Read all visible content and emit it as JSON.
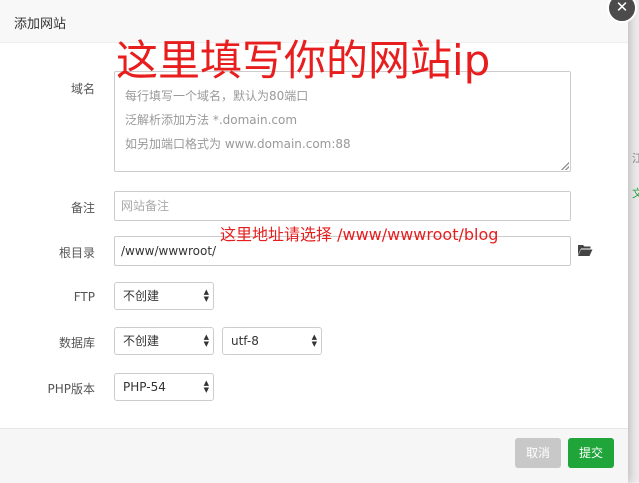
{
  "background": {
    "right_text": "文",
    "right_char": "江"
  },
  "dialog": {
    "title": "添加网站",
    "close_symbol": "✕"
  },
  "annotations": {
    "domain_hint": "这里填写你的网站ip",
    "path_hint": "这里地址请选择 /www/wwwroot/blog"
  },
  "form": {
    "domain": {
      "label": "域名",
      "placeholder_lines": [
        "每行填写一个域名，默认为80端口",
        "泛解析添加方法 *.domain.com",
        "如另加端口格式为 www.domain.com:88"
      ]
    },
    "remark": {
      "label": "备注",
      "placeholder": "网站备注"
    },
    "root": {
      "label": "根目录",
      "value": "/www/wwwroot/",
      "icon": "folder-open-icon"
    },
    "ftp": {
      "label": "FTP",
      "selected": "不创建"
    },
    "database": {
      "label": "数据库",
      "selected": "不创建",
      "charset": "utf-8"
    },
    "php": {
      "label": "PHP版本",
      "selected": "PHP-54"
    }
  },
  "footer": {
    "cancel_label": "取消",
    "submit_label": "提交"
  },
  "colors": {
    "accent": "#20a53a",
    "annotation": "#e81d1d",
    "cancel": "#c8c8c8"
  }
}
